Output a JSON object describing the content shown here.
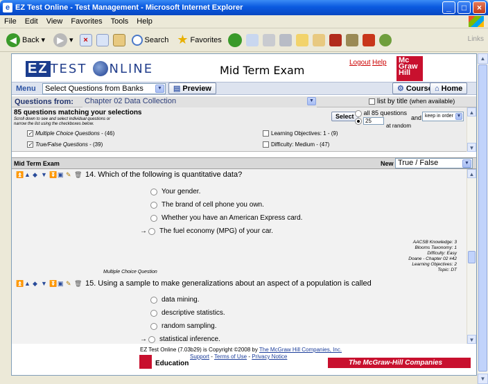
{
  "window": {
    "title": "EZ Test Online - Test Management - Microsoft Internet Explorer"
  },
  "menubar": [
    "File",
    "Edit",
    "View",
    "Favorites",
    "Tools",
    "Help"
  ],
  "toolbar": {
    "back": "Back",
    "search": "Search",
    "favorites": "Favorites",
    "links": "Links"
  },
  "header": {
    "logo_ez": "EZ",
    "logo_text": "TEST",
    "logo_text2": "NLINE",
    "exam_title": "Mid Term Exam",
    "logout": "Logout",
    "help": "Help",
    "mcgraw_logo": "Mc Graw Hill"
  },
  "menu": {
    "label": "Menu",
    "selected": "Select Questions from Banks",
    "preview": "Preview",
    "course": "Course",
    "home": "Home"
  },
  "questions_from": {
    "label": "Questions from:",
    "value": "Chapter 02 Data Collection",
    "list_by_title": "list by title",
    "list_by_title_note": "(when available)"
  },
  "match": {
    "headline": "85 questions matching your selections",
    "sub1": "Scroll down to see and select individual questions or",
    "sub2": "narrow the list using the checkboxes below.",
    "select_button": "Select",
    "all_label": "all 85 questions",
    "count_value": "25",
    "at_random": "at random",
    "and": "and",
    "order": "keep in order",
    "filters_left": [
      {
        "label": "Multiple Choice Questions",
        "count": "- (46)",
        "checked": true
      },
      {
        "label": "True/False Questions",
        "count": "- (39)",
        "checked": true
      }
    ],
    "filters_right": [
      {
        "label": "Learning Objectives: 1 - (9)",
        "checked": false
      },
      {
        "label": "Difficulty: Medium - (47)",
        "checked": false
      }
    ]
  },
  "test_bar": {
    "name": "Mid Term Exam",
    "new_label": "New",
    "new_type": "True / False"
  },
  "q14": {
    "number": "14.",
    "text": "Which of the following is quantitative data?",
    "options": [
      "Your gender.",
      "The brand of cell phone you own.",
      "Whether you have an American Express card.",
      "The fuel economy (MPG) of your car."
    ],
    "correct_index": 3,
    "meta": [
      "AACSB Knowledge: 3",
      "Blooms Taxonomy: 1",
      "Difficulty: Easy",
      "Doane - Chapter 02 #42",
      "Learning Objectives: 2",
      "Topic: DT"
    ],
    "type_label": "Multiple Choice Question"
  },
  "q15": {
    "number": "15.",
    "text": "Using a sample to make generalizations about an aspect of a population is called",
    "options": [
      "data mining.",
      "descriptive statistics.",
      "random sampling.",
      "statistical inference."
    ],
    "correct_index": 3
  },
  "footer": {
    "copyright_pre": "EZ Test Online (7.03b29) is Copyright ©2008 by",
    "copyright_link": "The McGraw Hill Companies, Inc.",
    "support": "Support",
    "sep1": " - ",
    "terms": "Terms of Use",
    "sep2": " - ",
    "privacy": "Privacy Notice",
    "education": "Education",
    "mhe": "The McGraw-Hill Companies"
  }
}
